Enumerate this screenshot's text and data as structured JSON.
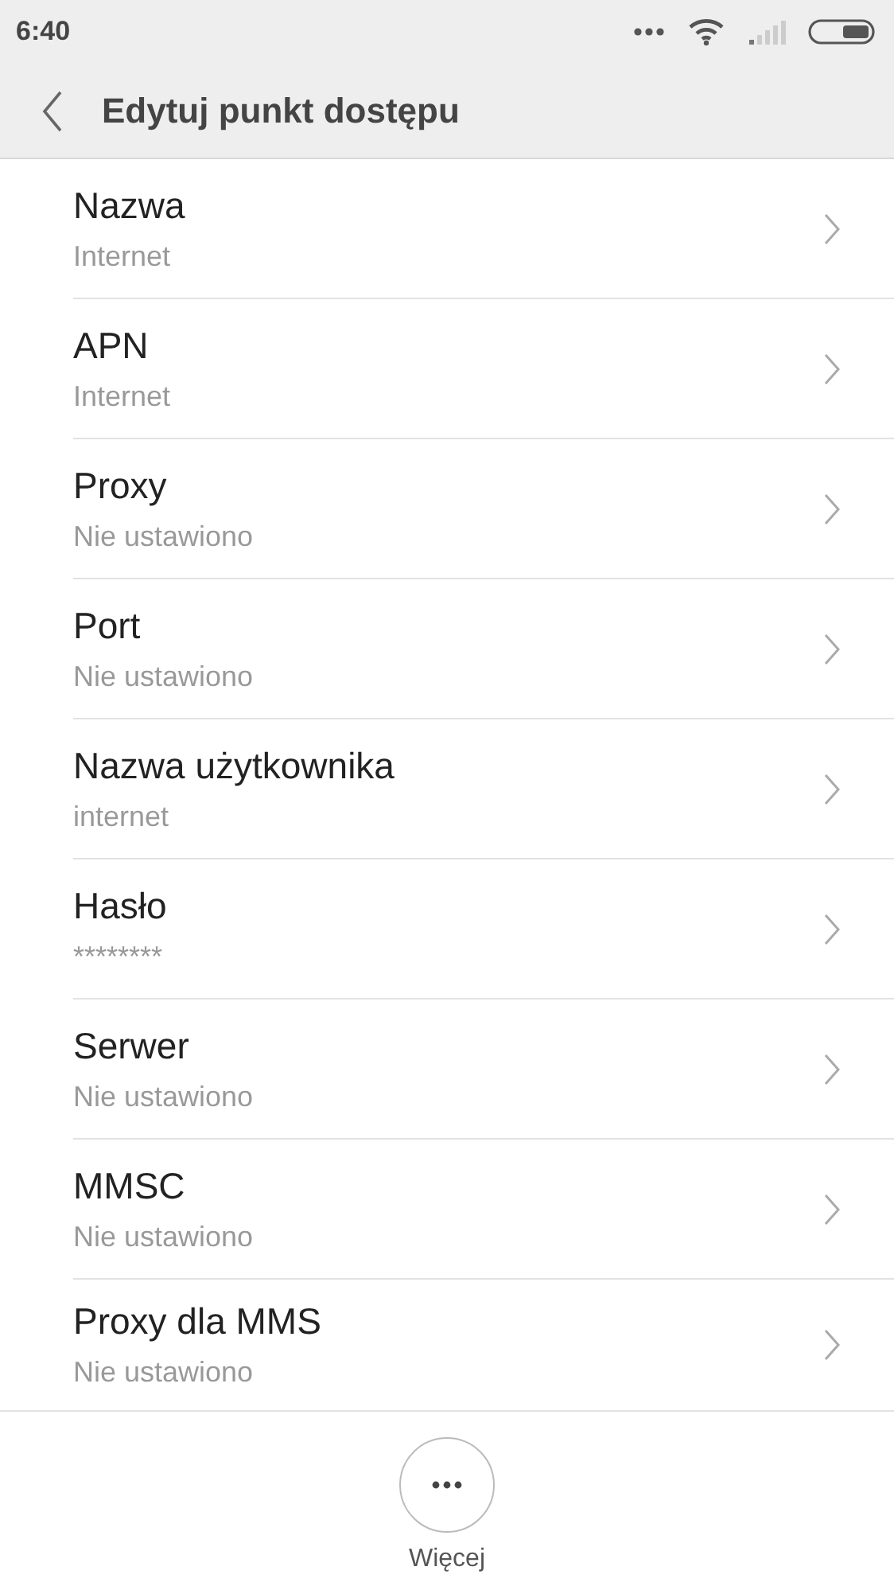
{
  "status_bar": {
    "time": "6:40"
  },
  "toolbar": {
    "title": "Edytuj punkt dostępu"
  },
  "settings": [
    {
      "label": "Nazwa",
      "value": "Internet"
    },
    {
      "label": "APN",
      "value": "Internet"
    },
    {
      "label": "Proxy",
      "value": "Nie ustawiono"
    },
    {
      "label": "Port",
      "value": "Nie ustawiono"
    },
    {
      "label": "Nazwa użytkownika",
      "value": "internet"
    },
    {
      "label": "Hasło",
      "value": "********"
    },
    {
      "label": "Serwer",
      "value": "Nie ustawiono"
    },
    {
      "label": "MMSC",
      "value": "Nie ustawiono"
    },
    {
      "label": "Proxy dla MMS",
      "value": "Nie ustawiono"
    }
  ],
  "bottom_bar": {
    "more_label": "Więcej"
  }
}
